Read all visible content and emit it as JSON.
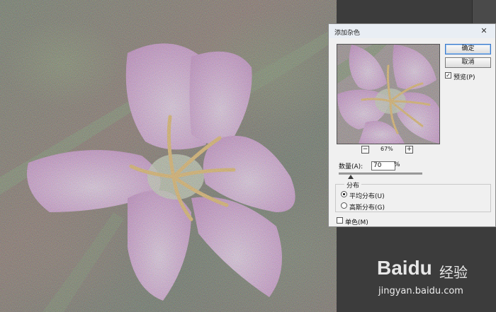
{
  "dialog": {
    "title": "添加杂色",
    "close_glyph": "✕",
    "ok_label": "确定",
    "cancel_label": "取消",
    "preview_label": "预览(P)",
    "preview_checked": true,
    "zoom": {
      "minus": "−",
      "plus": "+",
      "level": "67%"
    },
    "amount": {
      "label": "数量(A):",
      "value": "70",
      "unit": "%",
      "slider_fraction": 0.14
    },
    "distribution": {
      "legend": "分布",
      "options": [
        {
          "label": "平均分布(U)",
          "selected": true
        },
        {
          "label": "高斯分布(G)",
          "selected": false
        }
      ]
    },
    "monochrome": {
      "label": "单色(M)",
      "checked": false
    }
  },
  "watermark": {
    "brand": "Baidu",
    "product": "经验",
    "url": "jingyan.baidu.com"
  },
  "colors": {
    "petal": "#d08bd2",
    "stamen": "#e0a430",
    "dialog_bg": "#f0f0f0",
    "panel_bg": "#3c3c3c",
    "primary_button_border": "#3b78c9"
  },
  "icons": {
    "canvas_image": "flower-noise-image",
    "preview_image": "flower-preview-image"
  }
}
